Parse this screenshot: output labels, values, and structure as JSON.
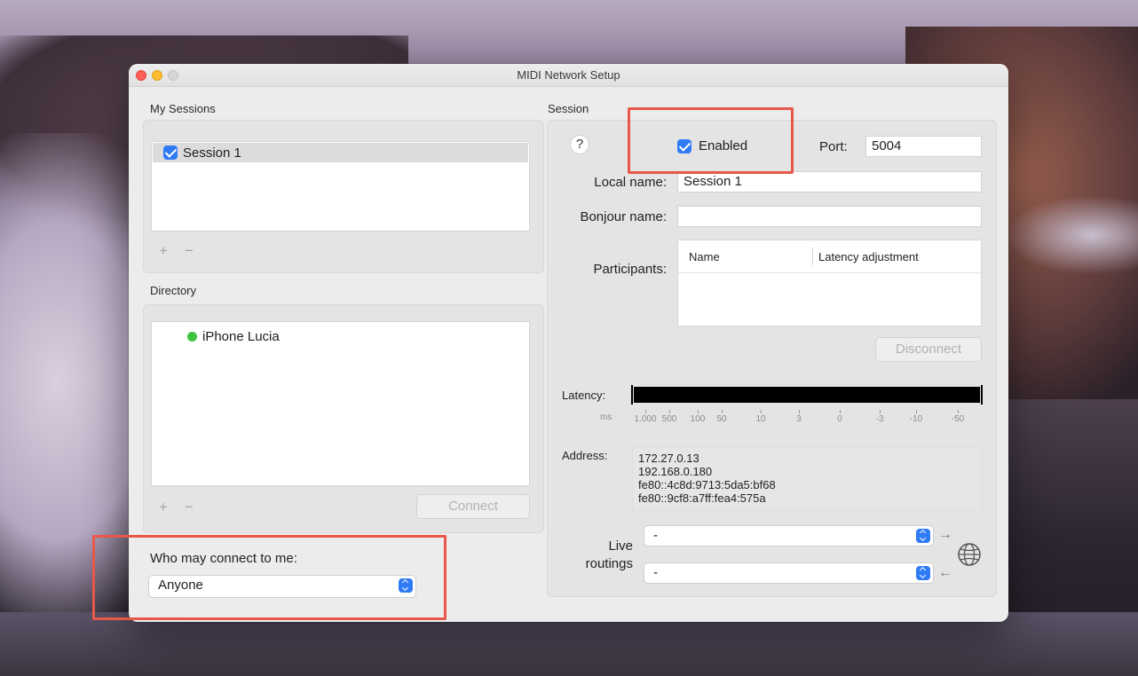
{
  "window": {
    "title": "MIDI Network Setup"
  },
  "my_sessions": {
    "label": "My Sessions",
    "items": [
      {
        "label": "Session 1",
        "checked": true
      }
    ],
    "add_symbol": "+",
    "remove_symbol": "−"
  },
  "directory": {
    "label": "Directory",
    "items": [
      {
        "label": "iPhone Lucia",
        "status_color": "#3ec33f"
      }
    ],
    "add_symbol": "+",
    "remove_symbol": "−",
    "connect_label": "Connect"
  },
  "who_may_connect": {
    "label": "Who may connect to me:",
    "value": "Anyone"
  },
  "session": {
    "label": "Session",
    "help_label": "?",
    "enabled_label": "Enabled",
    "enabled": true,
    "port_label": "Port:",
    "port_value": "5004",
    "local_name_label": "Local name:",
    "local_name_value": "Session 1",
    "bonjour_name_label": "Bonjour name:",
    "bonjour_name_value": "",
    "participants_label": "Participants:",
    "participants_columns": [
      "Name",
      "Latency adjustment"
    ],
    "disconnect_label": "Disconnect",
    "latency_label": "Latency:",
    "latency_unit": "ms",
    "latency_ticks": [
      "1.000",
      "500",
      "100",
      "50",
      "10",
      "3",
      "0",
      "-3",
      "-10",
      "-50"
    ],
    "address_label": "Address:",
    "addresses": [
      "172.27.0.13",
      "192.168.0.180",
      "fe80::4c8d:9713:5da5:bf68",
      "fe80::9cf8:a7ff:fea4:575a"
    ],
    "live_routings_label_line1": "Live",
    "live_routings_label_line2": "routings",
    "routing_out_value": "-",
    "routing_in_value": "-",
    "arrow_out": "→",
    "arrow_in": "←"
  },
  "colors": {
    "accent": "#2f7bf6",
    "highlight": "#e8584a",
    "online": "#3ec33f"
  },
  "icons": {
    "globe": "globe-icon",
    "help": "help-icon",
    "stepper": "chevron-updown-icon"
  }
}
